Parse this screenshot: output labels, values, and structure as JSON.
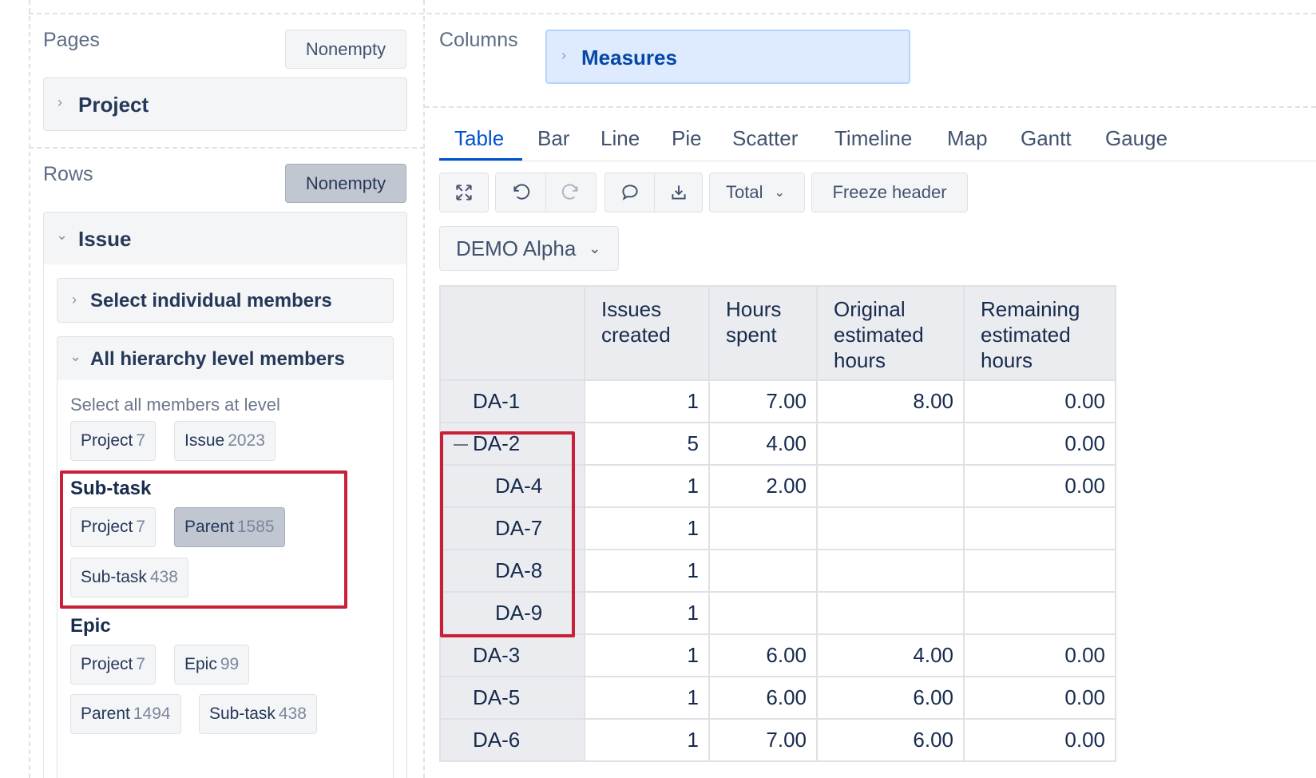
{
  "pages": {
    "title": "Pages",
    "nonempty_label": "Nonempty",
    "dimension": "Project"
  },
  "rows": {
    "title": "Rows",
    "nonempty_label": "Nonempty",
    "dimension": "Issue",
    "select_individual": "Select individual members",
    "all_hierarchy": "All hierarchy level members",
    "select_all_text": "Select all members at level",
    "default_levels": [
      {
        "label": "Project",
        "count": "7"
      },
      {
        "label": "Issue",
        "count": "2023"
      }
    ],
    "subtask": {
      "title": "Sub-task",
      "levels": [
        {
          "label": "Project",
          "count": "7"
        },
        {
          "label": "Parent",
          "count": "1585"
        },
        {
          "label": "Sub-task",
          "count": "438"
        }
      ]
    },
    "epic": {
      "title": "Epic",
      "levels": [
        {
          "label": "Project",
          "count": "7"
        },
        {
          "label": "Epic",
          "count": "99"
        },
        {
          "label": "Parent",
          "count": "1494"
        },
        {
          "label": "Sub-task",
          "count": "438"
        }
      ]
    }
  },
  "columns": {
    "title": "Columns",
    "dimension": "Measures"
  },
  "tabs": [
    "Table",
    "Bar",
    "Line",
    "Pie",
    "Scatter",
    "Timeline",
    "Map",
    "Gantt",
    "Gauge"
  ],
  "toolbar": {
    "total_label": "Total",
    "freeze_label": "Freeze header"
  },
  "page_filter": "DEMO Alpha",
  "table": {
    "headers": [
      "Issues created",
      "Hours spent",
      "Original estimated hours",
      "Remaining estimated hours"
    ],
    "rows": [
      {
        "name": "DA-1",
        "values": [
          "1",
          "7.00",
          "8.00",
          "0.00"
        ]
      },
      {
        "name": "DA-2",
        "values": [
          "5",
          "4.00",
          "",
          "0.00"
        ]
      },
      {
        "name": "DA-4",
        "values": [
          "1",
          "2.00",
          "",
          "0.00"
        ]
      },
      {
        "name": "DA-7",
        "values": [
          "1",
          "",
          "",
          ""
        ]
      },
      {
        "name": "DA-8",
        "values": [
          "1",
          "",
          "",
          ""
        ]
      },
      {
        "name": "DA-9",
        "values": [
          "1",
          "",
          "",
          ""
        ]
      },
      {
        "name": "DA-3",
        "values": [
          "1",
          "6.00",
          "4.00",
          "0.00"
        ]
      },
      {
        "name": "DA-5",
        "values": [
          "1",
          "6.00",
          "6.00",
          "0.00"
        ]
      },
      {
        "name": "DA-6",
        "values": [
          "1",
          "7.00",
          "6.00",
          "0.00"
        ]
      }
    ]
  }
}
